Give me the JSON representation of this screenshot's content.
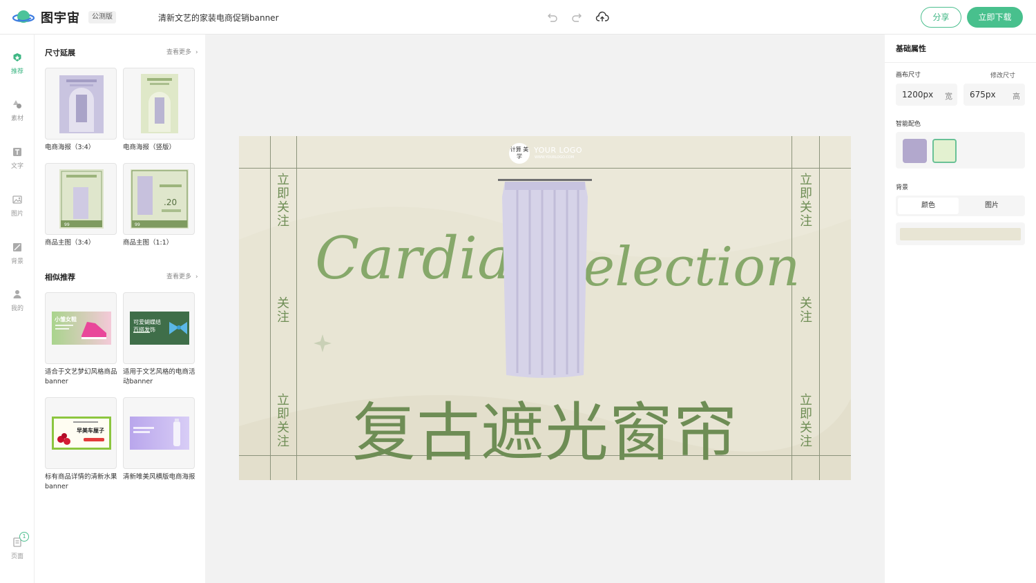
{
  "header": {
    "app_name": "图宇宙",
    "badge": "公测版",
    "doc_title": "清新文艺的家装电商促销banner",
    "undo_icon": "undo-icon",
    "redo_icon": "redo-icon",
    "cloud_icon": "cloud-upload-icon",
    "share_label": "分享",
    "download_label": "立即下载",
    "accent": "#48c08d"
  },
  "rail": {
    "items": [
      {
        "label": "推荐",
        "icon": "recommend-icon",
        "active": true
      },
      {
        "label": "素材",
        "icon": "shapes-icon"
      },
      {
        "label": "文字",
        "icon": "text-icon"
      },
      {
        "label": "图片",
        "icon": "image-icon"
      },
      {
        "label": "背景",
        "icon": "background-icon"
      },
      {
        "label": "我的",
        "icon": "user-icon"
      }
    ],
    "pages": {
      "label": "页面",
      "count": "1",
      "icon": "pages-icon"
    }
  },
  "panel": {
    "size_section": {
      "title": "尺寸延展",
      "more": "查看更多",
      "items": [
        {
          "label": "电商海报（3:4）"
        },
        {
          "label": "电商海报（竖版）"
        },
        {
          "label": "商品主图（3:4）"
        },
        {
          "label": "商品主图（1:1）"
        }
      ]
    },
    "similar_section": {
      "title": "相似推荐",
      "more": "查看更多",
      "items": [
        {
          "label": "适合于文艺梦幻风格商品banner",
          "thumb_text": "小雏女鞋"
        },
        {
          "label": "适用于文艺风格的电商活动banner",
          "thumb_text": "可爱蝴蝶结 百搭发饰"
        },
        {
          "label": "标有商品详情的清新水果banner",
          "thumb_text": "早美车厘子"
        },
        {
          "label": "清新唯美风横版电商海报"
        }
      ]
    }
  },
  "design": {
    "logo_circle": "计算 美学",
    "logo_main": "YOUR LOGO",
    "logo_sub": "WWW.YOURLOGO.COM",
    "side_top": "立即关注",
    "side_mid": "关注",
    "side_bottom": "立即关注",
    "script_left": "Cardia",
    "script_right": "election",
    "headline": "复古遮光窗帘",
    "bg_color": "#e8e5d4",
    "text_color": "#6e8d55"
  },
  "props": {
    "title": "基础属性",
    "canvas_size_label": "画布尺寸",
    "edit_size_label": "修改尺寸",
    "width_value": "1200px",
    "width_unit": "宽",
    "height_value": "675px",
    "height_unit": "高",
    "smart_color_label": "智能配色",
    "swatches": [
      "#b2a8cd",
      "#e3f1d0"
    ],
    "background_label": "背景",
    "bg_tabs": [
      "颜色",
      "图片"
    ],
    "bg_color": "#e8e5d4"
  }
}
